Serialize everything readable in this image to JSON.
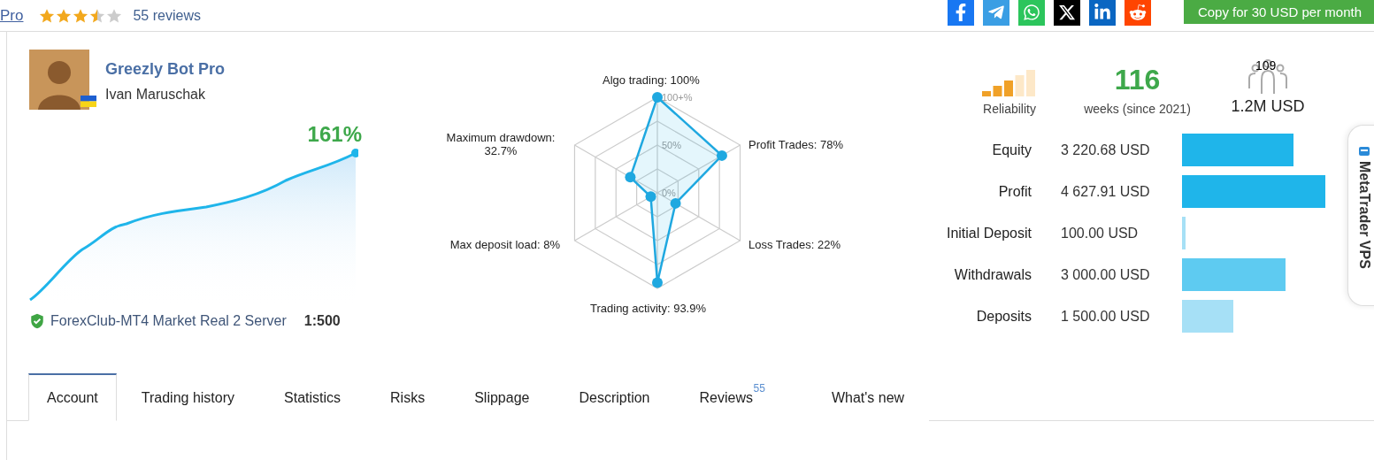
{
  "header": {
    "back_link": "Pro",
    "rating": {
      "stars": 3.5
    },
    "reviews": "55 reviews",
    "share": [
      {
        "kind": "facebook"
      },
      {
        "kind": "telegram"
      },
      {
        "kind": "whatsapp"
      },
      {
        "kind": "x"
      },
      {
        "kind": "linkedin"
      },
      {
        "kind": "reddit"
      }
    ],
    "copy_button": "Copy for 30 USD per month"
  },
  "signal": {
    "name": "Greezly Bot Pro",
    "author": "Ivan Maruschak",
    "growth": "161%",
    "server": "ForexClub-MT4 Market Real 2 Server",
    "leverage": "1:500"
  },
  "radar": {
    "ring_labels": [
      "100+%",
      "50%",
      "0%"
    ],
    "axes": [
      {
        "label": "Algo trading: 100%"
      },
      {
        "label": "Maximum drawdown: 32.7%"
      },
      {
        "label": "Profit Trades: 78%"
      },
      {
        "label": "Max deposit load: 8%"
      },
      {
        "label": "Loss Trades: 22%"
      },
      {
        "label": "Trading activity: 93.9%"
      }
    ]
  },
  "stats": {
    "reliability": {
      "label": "Reliability",
      "level": 0.6
    },
    "weeks": {
      "value": "116",
      "label": "weeks (since 2021)"
    },
    "subscribers": {
      "count": "109",
      "funds": "1.2M USD"
    }
  },
  "balances": [
    {
      "label": "Equity",
      "value": "3 220.68 USD",
      "color": "#1fb5ea"
    },
    {
      "label": "Profit",
      "value": "4 627.91 USD",
      "color": "#1fb5ea"
    },
    {
      "label": "Initial Deposit",
      "value": "100.00 USD",
      "color": "#a6e0f6"
    },
    {
      "label": "Withdrawals",
      "value": "3 000.00 USD",
      "color": "#5ecbf1"
    },
    {
      "label": "Deposits",
      "value": "1 500.00 USD",
      "color": "#a6e0f6"
    }
  ],
  "side_tab": "MetaTrader VPS",
  "tabs": [
    {
      "label": "Account",
      "selected": true
    },
    {
      "label": "Trading history",
      "selected": false
    },
    {
      "label": "Statistics",
      "selected": false
    },
    {
      "label": "Risks",
      "selected": false
    },
    {
      "label": "Slippage",
      "selected": false
    },
    {
      "label": "Description",
      "selected": false
    },
    {
      "label": "Reviews",
      "selected": false,
      "badge": "55"
    },
    {
      "label": "What's new",
      "selected": false
    }
  ]
}
